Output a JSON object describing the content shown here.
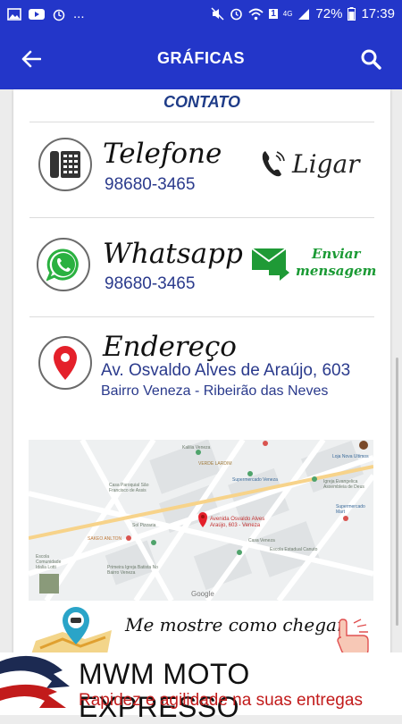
{
  "status_bar": {
    "left_icons": [
      "image-icon",
      "youtube-icon",
      "alarm-snooze-icon",
      "more-icon"
    ],
    "more_label": "...",
    "network_label": "4G",
    "sim_label": "1",
    "battery_label": "72%",
    "time": "17:39"
  },
  "app_bar": {
    "title": "GRÁFICAS"
  },
  "contact": {
    "section_title": "CONTATO",
    "telefone": {
      "label": "Telefone",
      "value": "98680-3465",
      "action_label": "Ligar"
    },
    "whatsapp": {
      "label": "Whatsapp",
      "value": "98680-3465",
      "action_line1": "Enviar",
      "action_line2": "mensagem"
    },
    "endereco": {
      "label": "Endereço",
      "street": "Av. Osvaldo Alves de Araújo, 603",
      "district": "Bairro Veneza - Ribeirão das Neves"
    }
  },
  "map": {
    "pin_label_1": "Avenida Osvaldo Alves",
    "pin_label_2": "Araújo, 603 - Veneza",
    "places": [
      "Kalilia Veneza",
      "VERDE LARDIM",
      "Sol Pizzaria",
      "Supermercado Veneza",
      "Casa Paroquial São Francisco de Assis",
      "SAKEO ANLTON",
      "Escola Comunidade Idalia Lotti",
      "Primeira Igreja Batista No Bairro Veneza",
      "Escola Estadual Canuto",
      "Casa Veneza",
      "Igreja Evangelica Assembleia de Deus",
      "Loja Nova Ultimos",
      "Supermercado Mart"
    ],
    "attribution": "Google"
  },
  "directions": {
    "label": "Me mostre como chegar"
  },
  "footer": {
    "title": "MWM MOTO EXPRESSO",
    "subtitle": "Rapidez e agilidade na suas entregas"
  },
  "colors": {
    "primary": "#2336c9",
    "section_title": "#1f3c88",
    "value_text": "#2a3a8c",
    "whatsapp_green": "#1a9a34",
    "pin_red": "#e4202a",
    "footer_red": "#c21b1b"
  }
}
